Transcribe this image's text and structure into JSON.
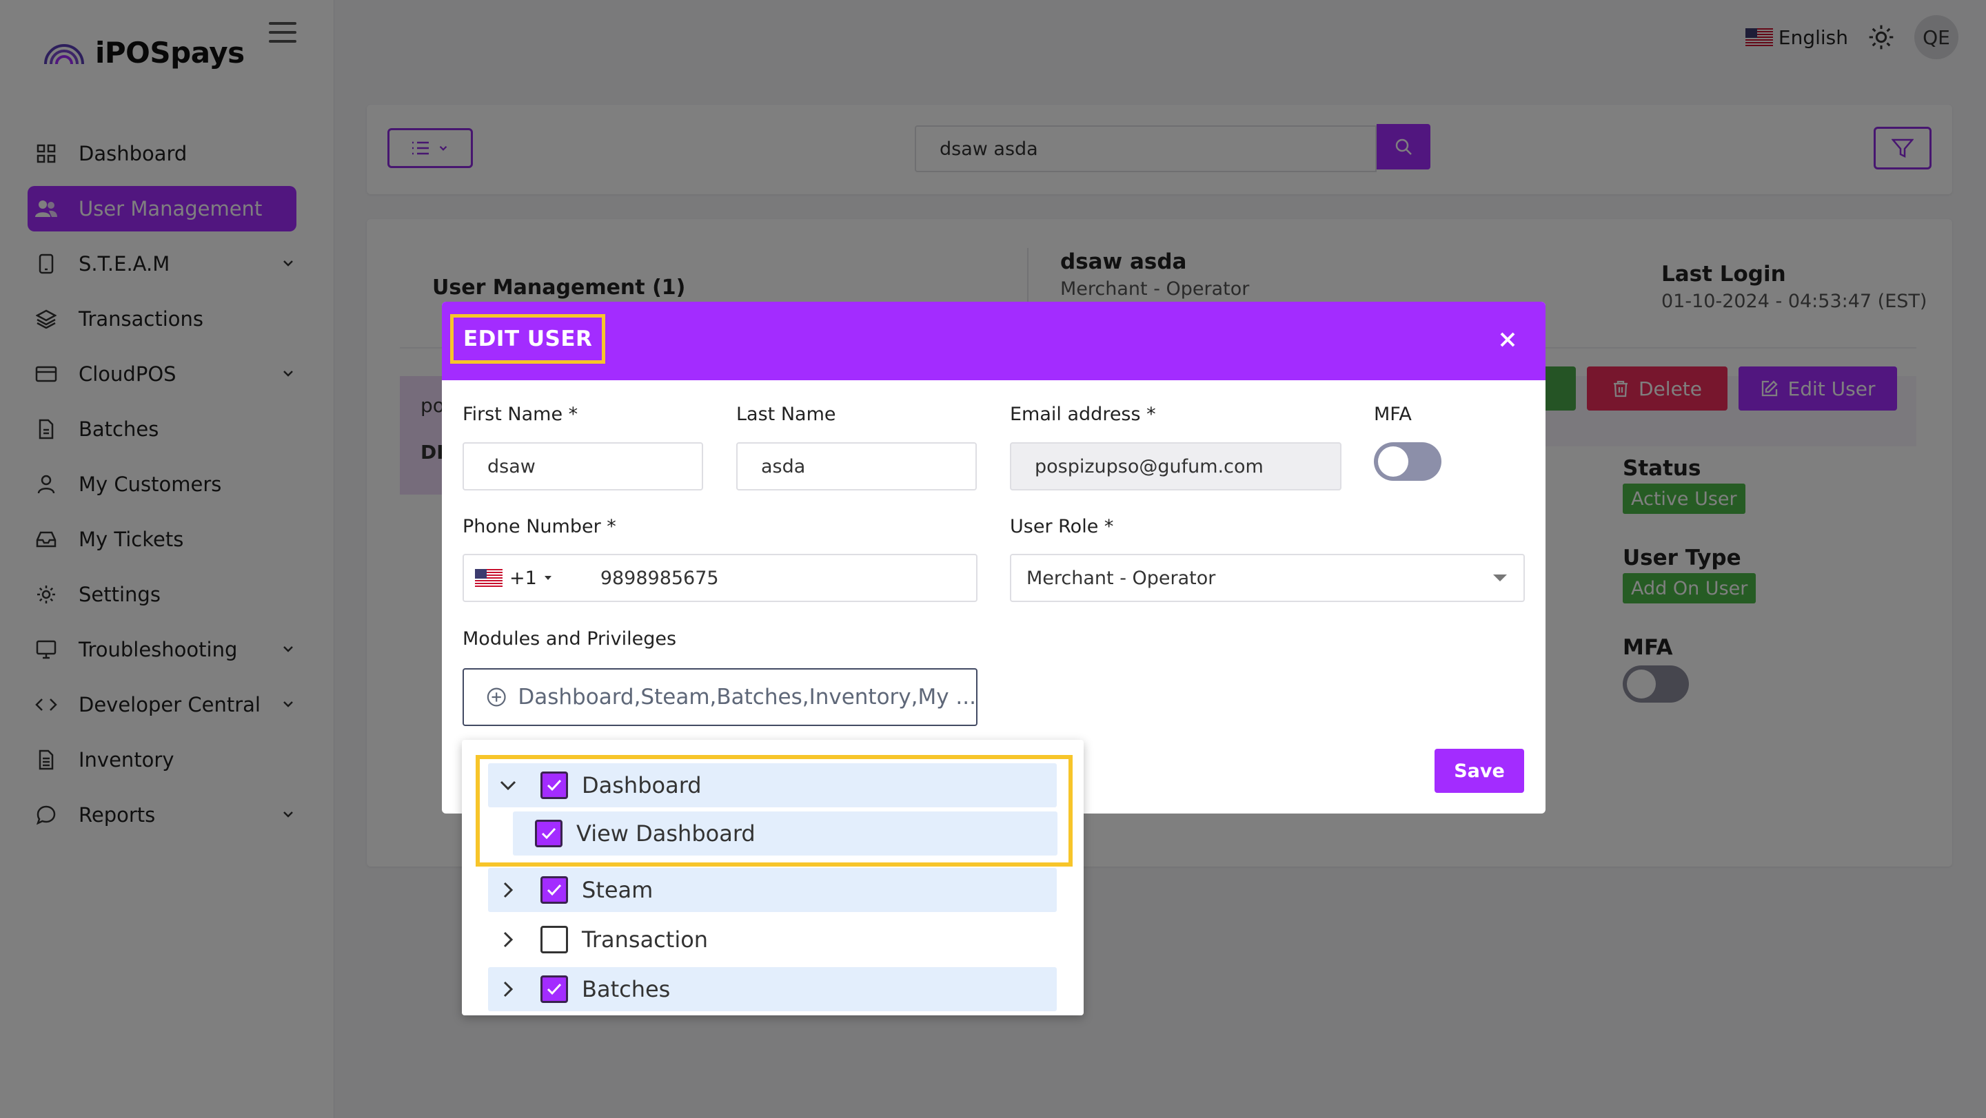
{
  "app": {
    "brand": "iPOSpays",
    "language": "English",
    "avatar_initials": "QE",
    "accent_color": "#a32cff",
    "highlight_color": "#f7c52a"
  },
  "sidebar": {
    "items": [
      {
        "label": "Dashboard",
        "icon": "grid-icon",
        "expandable": false,
        "active": false
      },
      {
        "label": "User Management",
        "icon": "users-icon",
        "expandable": false,
        "active": true
      },
      {
        "label": "S.T.E.A.M",
        "icon": "tablet-icon",
        "expandable": true,
        "active": false
      },
      {
        "label": "Transactions",
        "icon": "layers-icon",
        "expandable": false,
        "active": false
      },
      {
        "label": "CloudPOS",
        "icon": "credit-card-icon",
        "expandable": true,
        "active": false
      },
      {
        "label": "Batches",
        "icon": "file-icon",
        "expandable": false,
        "active": false
      },
      {
        "label": "My Customers",
        "icon": "person-icon",
        "expandable": false,
        "active": false
      },
      {
        "label": "My Tickets",
        "icon": "inbox-icon",
        "expandable": false,
        "active": false
      },
      {
        "label": "Settings",
        "icon": "gear-icon",
        "expandable": false,
        "active": false
      },
      {
        "label": "Troubleshooting",
        "icon": "monitor-icon",
        "expandable": true,
        "active": false
      },
      {
        "label": "Developer Central",
        "icon": "code-icon",
        "expandable": true,
        "active": false
      },
      {
        "label": "Inventory",
        "icon": "document-icon",
        "expandable": false,
        "active": false
      },
      {
        "label": "Reports",
        "icon": "chat-icon",
        "expandable": true,
        "active": false
      }
    ]
  },
  "search": {
    "value": "dsaw asda"
  },
  "user_panel": {
    "title": "User Management (1)",
    "user_name": "dsaw asda",
    "user_role": "Merchant - Operator",
    "last_login_label": "Last Login",
    "last_login_value": "01-10-2024 - 04:53:47 (EST)",
    "row_cell_a": "po",
    "row_cell_b": "DE",
    "delete_label": "Delete",
    "edit_user_label": "Edit User",
    "status_label": "Status",
    "status_value": "Active User",
    "user_type_label": "User Type",
    "user_type_value": "Add On User",
    "mfa_label": "MFA"
  },
  "modal": {
    "title": "EDIT USER",
    "first_name_label": "First Name *",
    "first_name_value": "dsaw",
    "last_name_label": "Last Name",
    "last_name_value": "asda",
    "email_label": "Email address *",
    "email_value": "pospizupso@gufum.com",
    "mfa_label": "MFA",
    "mfa_enabled": false,
    "phone_label": "Phone Number *",
    "phone_country_code": "+1",
    "phone_value": "9898985675",
    "role_label": "User Role *",
    "role_value": "Merchant - Operator",
    "modules_label": "Modules and Privileges",
    "modules_value": "Dashboard,Steam,Batches,Inventory,My ...",
    "save_label": "Save"
  },
  "tree": {
    "items": [
      {
        "label": "Dashboard",
        "checked": true,
        "expanded": true,
        "level": 0
      },
      {
        "label": "View Dashboard",
        "checked": true,
        "expanded": false,
        "level": 1
      },
      {
        "label": "Steam",
        "checked": true,
        "expanded": false,
        "level": 0
      },
      {
        "label": "Transaction",
        "checked": false,
        "expanded": false,
        "level": 0
      },
      {
        "label": "Batches",
        "checked": true,
        "expanded": false,
        "level": 0
      }
    ]
  }
}
